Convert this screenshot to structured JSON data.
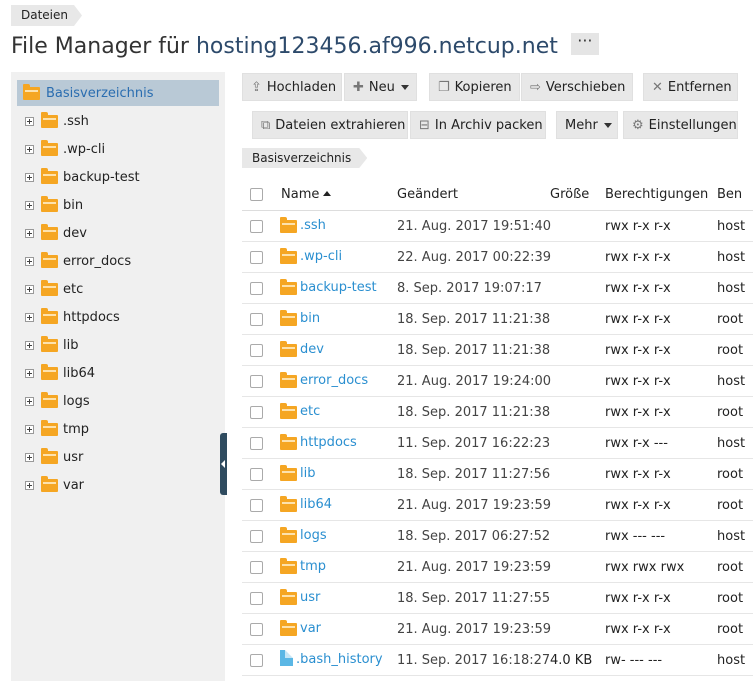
{
  "breadcrumb": {
    "label": "Dateien"
  },
  "title": {
    "prefix": "File Manager für",
    "host": "hosting123456.af996.netcup.net",
    "more": "···"
  },
  "sidebar": {
    "root": "Basisverzeichnis",
    "items": [
      ".ssh",
      ".wp-cli",
      "backup-test",
      "bin",
      "dev",
      "error_docs",
      "etc",
      "httpdocs",
      "lib",
      "lib64",
      "logs",
      "tmp",
      "usr",
      "var"
    ]
  },
  "toolbar": {
    "upload": "Hochladen",
    "new": "Neu",
    "copy": "Kopieren",
    "move": "Verschieben",
    "remove": "Entfernen",
    "extract": "Dateien extrahieren",
    "archive": "In Archiv packen",
    "more": "Mehr",
    "settings": "Einstellungen"
  },
  "path": "Basisverzeichnis",
  "table": {
    "headers": {
      "name": "Name",
      "changed": "Geändert",
      "size": "Größe",
      "perms": "Berechtigungen",
      "user": "Ben"
    },
    "rows": [
      {
        "name": ".ssh",
        "type": "folder",
        "changed": "21. Aug. 2017 19:51:40",
        "size": "",
        "perms": "rwx r-x r-x",
        "user": "host"
      },
      {
        "name": ".wp-cli",
        "type": "folder",
        "changed": "22. Aug. 2017 00:22:39",
        "size": "",
        "perms": "rwx r-x r-x",
        "user": "host"
      },
      {
        "name": "backup-test",
        "type": "folder",
        "changed": "8. Sep. 2017 19:07:17",
        "size": "",
        "perms": "rwx r-x r-x",
        "user": "host"
      },
      {
        "name": "bin",
        "type": "folder",
        "changed": "18. Sep. 2017 11:21:38",
        "size": "",
        "perms": "rwx r-x r-x",
        "user": "root"
      },
      {
        "name": "dev",
        "type": "folder",
        "changed": "18. Sep. 2017 11:21:38",
        "size": "",
        "perms": "rwx r-x r-x",
        "user": "root"
      },
      {
        "name": "error_docs",
        "type": "folder",
        "changed": "21. Aug. 2017 19:24:00",
        "size": "",
        "perms": "rwx r-x r-x",
        "user": "host"
      },
      {
        "name": "etc",
        "type": "folder",
        "changed": "18. Sep. 2017 11:21:38",
        "size": "",
        "perms": "rwx r-x r-x",
        "user": "root"
      },
      {
        "name": "httpdocs",
        "type": "folder",
        "changed": "11. Sep. 2017 16:22:23",
        "size": "",
        "perms": "rwx r-x ---",
        "user": "host"
      },
      {
        "name": "lib",
        "type": "folder",
        "changed": "18. Sep. 2017 11:27:56",
        "size": "",
        "perms": "rwx r-x r-x",
        "user": "root"
      },
      {
        "name": "lib64",
        "type": "folder",
        "changed": "21. Aug. 2017 19:23:59",
        "size": "",
        "perms": "rwx r-x r-x",
        "user": "root"
      },
      {
        "name": "logs",
        "type": "folder",
        "changed": "18. Sep. 2017 06:27:52",
        "size": "",
        "perms": "rwx --- ---",
        "user": "host"
      },
      {
        "name": "tmp",
        "type": "folder",
        "changed": "21. Aug. 2017 19:23:59",
        "size": "",
        "perms": "rwx rwx rwx",
        "user": "root"
      },
      {
        "name": "usr",
        "type": "folder",
        "changed": "18. Sep. 2017 11:27:55",
        "size": "",
        "perms": "rwx r-x r-x",
        "user": "root"
      },
      {
        "name": "var",
        "type": "folder",
        "changed": "21. Aug. 2017 19:23:59",
        "size": "",
        "perms": "rwx r-x r-x",
        "user": "root"
      },
      {
        "name": ".bash_history",
        "type": "file",
        "changed": "11. Sep. 2017 16:18:27",
        "size": "4.0 KB",
        "perms": "rw- --- ---",
        "user": "host"
      }
    ]
  },
  "colors": {
    "link": "#2a8fd0",
    "folder": "#f5a623",
    "selected": "#b9c9d6",
    "handle": "#2f4b5f"
  }
}
